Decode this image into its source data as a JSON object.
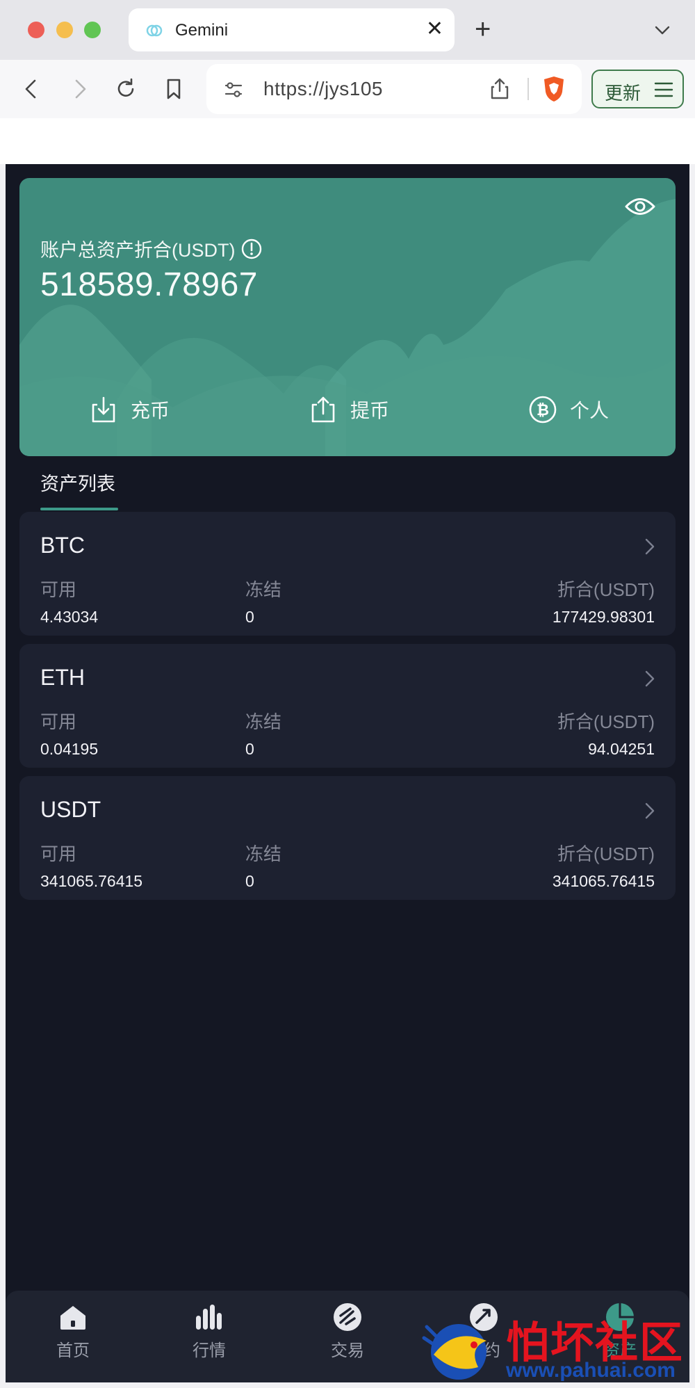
{
  "browser": {
    "tab_title": "Gemini",
    "tab_close": "✕",
    "new_tab": "+",
    "url": "https://jys105",
    "update_label": "更新"
  },
  "hero": {
    "asset_label": "账户总资产折合(USDT)",
    "asset_value": "518589.78967",
    "actions": [
      {
        "label": "充币",
        "icon": "download-icon"
      },
      {
        "label": "提币",
        "icon": "upload-icon"
      },
      {
        "label": "个人",
        "icon": "bitcoin-icon"
      }
    ]
  },
  "asset_list": {
    "title": "资产列表",
    "columns": [
      "可用",
      "冻结",
      "折合(USDT)"
    ],
    "items": [
      {
        "coin": "BTC",
        "available": "4.43034",
        "frozen": "0",
        "usdt": "177429.98301"
      },
      {
        "coin": "ETH",
        "available": "0.04195",
        "frozen": "0",
        "usdt": "94.04251"
      },
      {
        "coin": "USDT",
        "available": "341065.76415",
        "frozen": "0",
        "usdt": "341065.76415"
      }
    ]
  },
  "tabbar": {
    "items": [
      {
        "label": "首页",
        "icon": "home-icon"
      },
      {
        "label": "行情",
        "icon": "chart-bars-icon"
      },
      {
        "label": "交易",
        "icon": "exchange-icon"
      },
      {
        "label": "合约",
        "icon": "contract-icon"
      },
      {
        "label": "资产",
        "icon": "assets-pie-icon"
      }
    ],
    "active_index": 4
  },
  "watermark": {
    "title": "怕坏社区",
    "url": "www.pahuai.com"
  },
  "colors": {
    "accent": "#3d9a89",
    "hero_bg": "#3f8c7d",
    "app_bg": "#141723",
    "card_bg": "#1d2130"
  }
}
